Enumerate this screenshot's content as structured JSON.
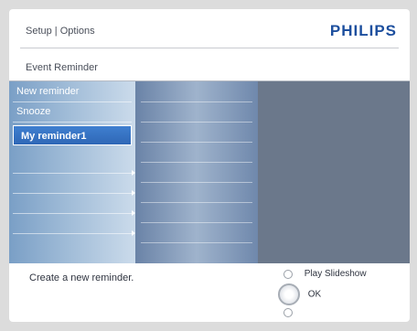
{
  "header": {
    "breadcrumb": "Setup | Options",
    "brand": "PHILIPS",
    "subtitle": "Event Reminder"
  },
  "menu": {
    "items": [
      {
        "label": "New reminder",
        "selected": false
      },
      {
        "label": "Snooze",
        "selected": false
      },
      {
        "label": "My reminder1",
        "selected": true
      }
    ]
  },
  "footer": {
    "status": "Create a new reminder.",
    "hints": [
      {
        "label": "Play Slideshow",
        "icon": "small-circle-icon"
      },
      {
        "label": "OK",
        "icon": "ok-button-icon"
      },
      {
        "label": "",
        "icon": "small-circle-icon"
      }
    ]
  },
  "colors": {
    "brand": "#1d4f9e",
    "selection": "#3f7fd0",
    "preview_panel": "#6b788b"
  }
}
